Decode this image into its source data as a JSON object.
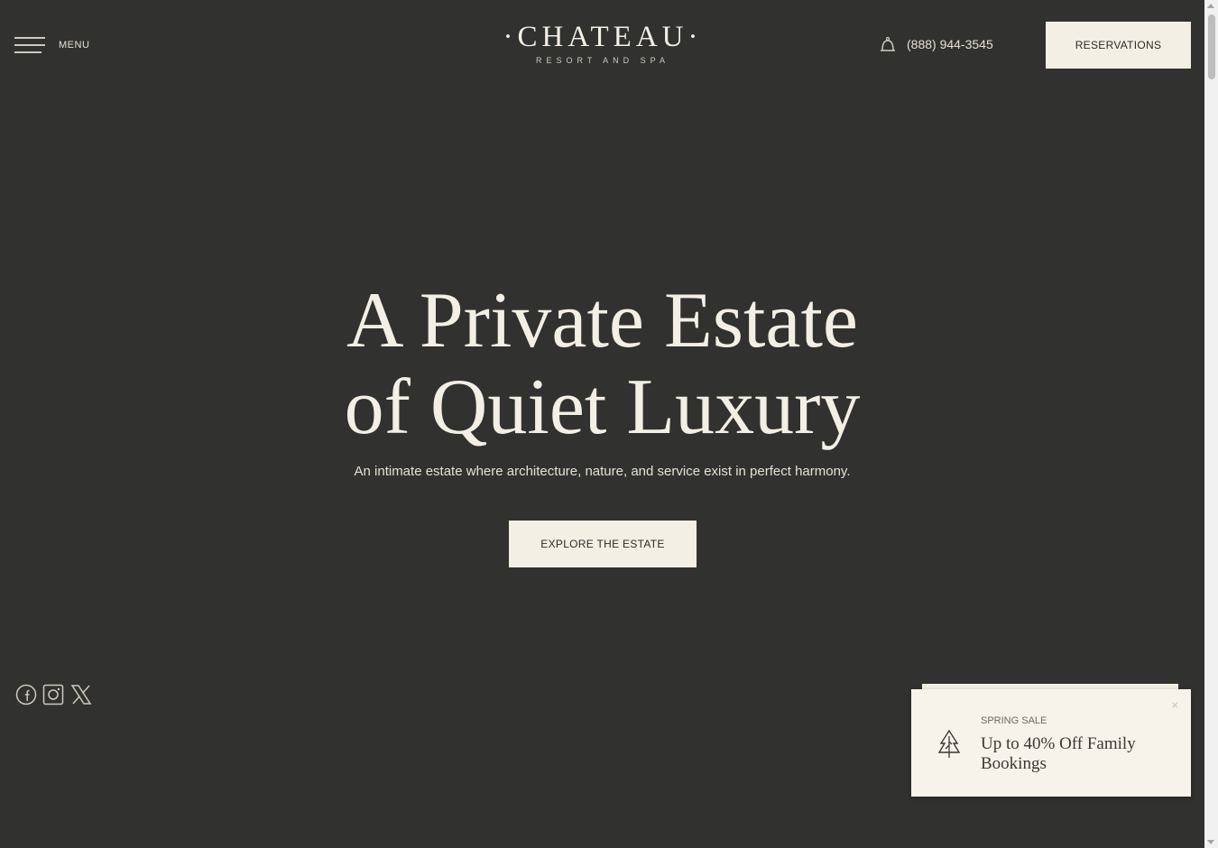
{
  "header": {
    "menu_label": "MENU",
    "logo_name": "·CHATEAU·",
    "logo_subtitle": "RESORT AND SPA",
    "phone": "(888) 944-3545",
    "reservations_label": "RESERVATIONS",
    "icons": {
      "menu": "hamburger-icon",
      "phone": "bell-icon"
    }
  },
  "hero": {
    "title_line1": "A Private Estate",
    "title_line2": "of Quiet Luxury",
    "subtitle": "An intimate estate where architecture, nature, and service exist in perfect harmony.",
    "cta_label": "EXPLORE THE ESTATE"
  },
  "social": {
    "icons": [
      "facebook-icon",
      "instagram-icon",
      "x-icon"
    ]
  },
  "promo": {
    "eyebrow": "SPRING SALE",
    "title": "Up to 40% Off Family Bookings",
    "close_glyph": "×",
    "icon": "tree-icon"
  },
  "colors": {
    "background": "#31312f",
    "cream": "#f3efe4",
    "dark_text": "#2b2a28"
  }
}
